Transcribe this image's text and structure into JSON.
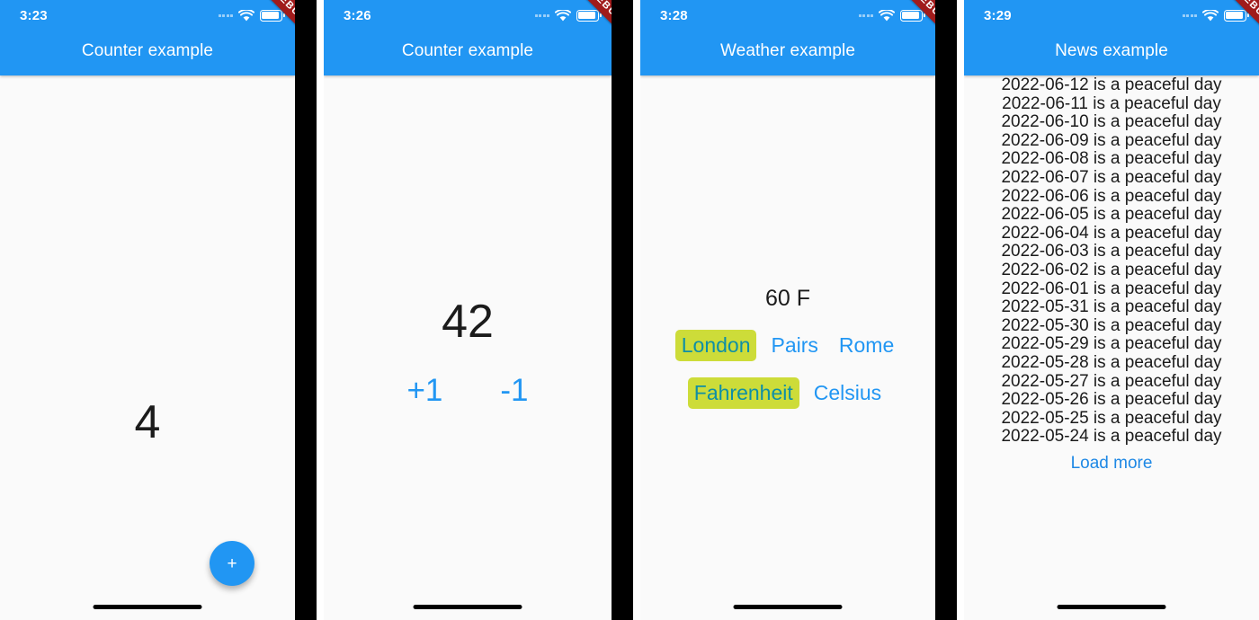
{
  "debug_banner": "DEBUG",
  "panels": [
    {
      "id": "counter-simple",
      "status": {
        "time": "3:23",
        "wifi_icon": "wifi-icon",
        "battery_icon": "battery-icon",
        "signal_icon": "signal-dots-icon"
      },
      "title": "Counter example",
      "counter_value": "4",
      "fab_label": "+",
      "fab_icon": "plus-icon"
    },
    {
      "id": "counter-buttons",
      "status": {
        "time": "3:26",
        "wifi_icon": "wifi-icon",
        "battery_icon": "battery-icon",
        "signal_icon": "signal-dots-icon"
      },
      "title": "Counter example",
      "counter_value": "42",
      "increment_label": "+1",
      "decrement_label": "-1"
    },
    {
      "id": "weather",
      "status": {
        "time": "3:28",
        "wifi_icon": "wifi-icon",
        "battery_icon": "battery-icon",
        "signal_icon": "signal-dots-icon"
      },
      "title": "Weather example",
      "temperature": "60 F",
      "cities": [
        {
          "label": "London",
          "selected": true
        },
        {
          "label": "Pairs",
          "selected": false
        },
        {
          "label": "Rome",
          "selected": false
        }
      ],
      "units": [
        {
          "label": "Fahrenheit",
          "selected": true
        },
        {
          "label": "Celsius",
          "selected": false
        }
      ]
    },
    {
      "id": "news",
      "status": {
        "time": "3:29",
        "wifi_icon": "wifi-icon",
        "battery_icon": "battery-icon",
        "signal_icon": "signal-dots-icon"
      },
      "title": "News example",
      "items": [
        "2022-06-12 is a peaceful day",
        "2022-06-11 is a peaceful day",
        "2022-06-10 is a peaceful day",
        "2022-06-09 is a peaceful day",
        "2022-06-08 is a peaceful day",
        "2022-06-07 is a peaceful day",
        "2022-06-06 is a peaceful day",
        "2022-06-05 is a peaceful day",
        "2022-06-04 is a peaceful day",
        "2022-06-03 is a peaceful day",
        "2022-06-02 is a peaceful day",
        "2022-06-01 is a peaceful day",
        "2022-05-31 is a peaceful day",
        "2022-05-30 is a peaceful day",
        "2022-05-29 is a peaceful day",
        "2022-05-28 is a peaceful day",
        "2022-05-27 is a peaceful day",
        "2022-05-26 is a peaceful day",
        "2022-05-25 is a peaceful day",
        "2022-05-24 is a peaceful day"
      ],
      "load_more_label": "Load more"
    }
  ],
  "colors": {
    "appbar": "#2196f3",
    "accent": "#2196f3",
    "highlight": "#cddc39",
    "highlight_text": "#0e8fa6",
    "debug_ribbon": "#a01b1b",
    "screen_bg": "#fafafa"
  }
}
